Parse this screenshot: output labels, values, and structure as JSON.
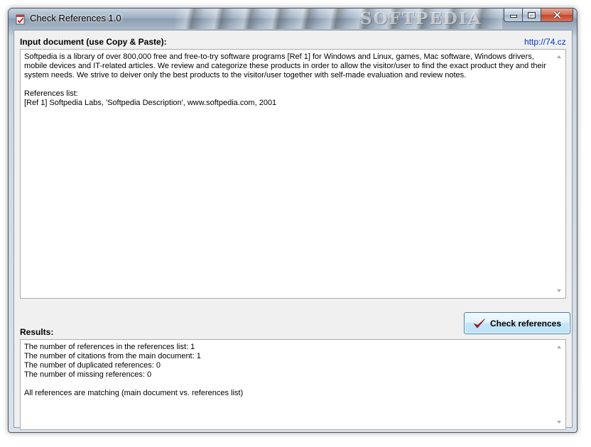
{
  "window": {
    "title": "Check References 1.0",
    "watermark": "SOFTPEDIA"
  },
  "input_section": {
    "label": "Input document (use Copy & Paste):",
    "link": "http://74.cz",
    "text": "Softpedia is a library of over 800,000 free and free-to-try software programs [Ref 1] for Windows and Linux, games, Mac software, Windows drivers,\nmobile devices and IT-related articles. We review and categorize these products in order to allow the visitor/user to find the exact product they and their\nsystem needs. We strive to deiver only the best products to the visitor/user together with self-made evaluation and review notes.\n\nReferences list:\n[Ref 1] Softpedia Labs, 'Softpedia Description', www.softpedia.com, 2001"
  },
  "check_button": {
    "label": "Check references",
    "icon": "checkmark-icon",
    "icon_color": "#c0181e"
  },
  "results_section": {
    "label": "Results:",
    "text": "The number of references in the references list: 1\nThe number of citations from the main document: 1\nThe number of duplicated references: 0\nThe number of missing references: 0\n\nAll references are matching (main document vs. references list)"
  }
}
